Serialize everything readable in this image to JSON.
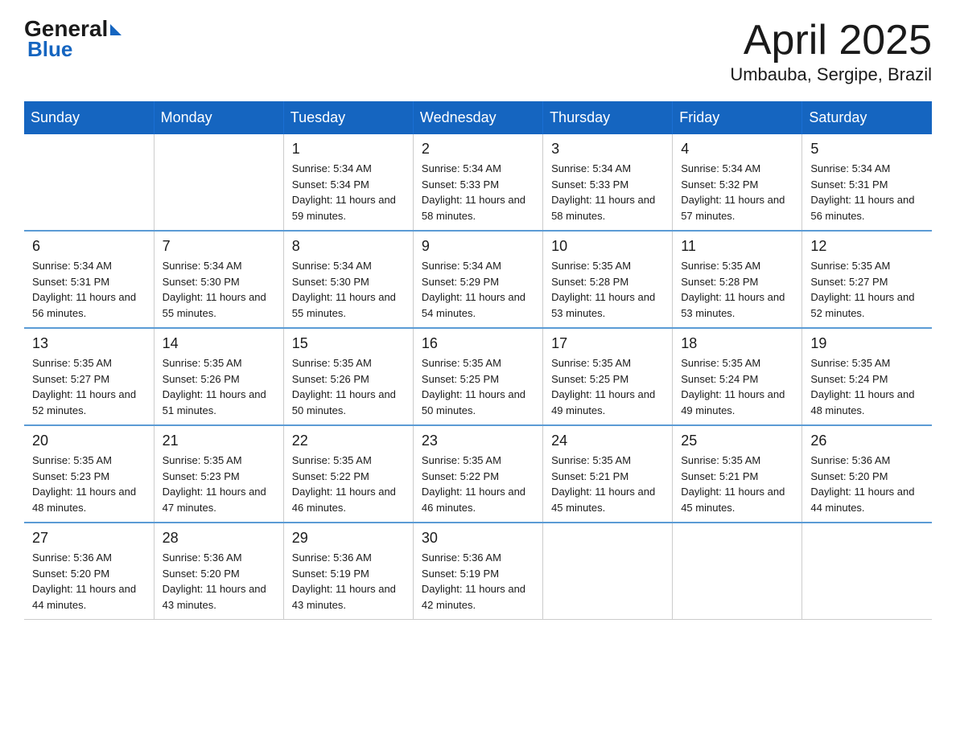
{
  "header": {
    "logo_general": "General",
    "logo_blue": "Blue",
    "month_title": "April 2025",
    "location": "Umbauba, Sergipe, Brazil"
  },
  "weekdays": [
    "Sunday",
    "Monday",
    "Tuesday",
    "Wednesday",
    "Thursday",
    "Friday",
    "Saturday"
  ],
  "weeks": [
    [
      {
        "day": "",
        "sunrise": "",
        "sunset": "",
        "daylight": ""
      },
      {
        "day": "",
        "sunrise": "",
        "sunset": "",
        "daylight": ""
      },
      {
        "day": "1",
        "sunrise": "Sunrise: 5:34 AM",
        "sunset": "Sunset: 5:34 PM",
        "daylight": "Daylight: 11 hours and 59 minutes."
      },
      {
        "day": "2",
        "sunrise": "Sunrise: 5:34 AM",
        "sunset": "Sunset: 5:33 PM",
        "daylight": "Daylight: 11 hours and 58 minutes."
      },
      {
        "day": "3",
        "sunrise": "Sunrise: 5:34 AM",
        "sunset": "Sunset: 5:33 PM",
        "daylight": "Daylight: 11 hours and 58 minutes."
      },
      {
        "day": "4",
        "sunrise": "Sunrise: 5:34 AM",
        "sunset": "Sunset: 5:32 PM",
        "daylight": "Daylight: 11 hours and 57 minutes."
      },
      {
        "day": "5",
        "sunrise": "Sunrise: 5:34 AM",
        "sunset": "Sunset: 5:31 PM",
        "daylight": "Daylight: 11 hours and 56 minutes."
      }
    ],
    [
      {
        "day": "6",
        "sunrise": "Sunrise: 5:34 AM",
        "sunset": "Sunset: 5:31 PM",
        "daylight": "Daylight: 11 hours and 56 minutes."
      },
      {
        "day": "7",
        "sunrise": "Sunrise: 5:34 AM",
        "sunset": "Sunset: 5:30 PM",
        "daylight": "Daylight: 11 hours and 55 minutes."
      },
      {
        "day": "8",
        "sunrise": "Sunrise: 5:34 AM",
        "sunset": "Sunset: 5:30 PM",
        "daylight": "Daylight: 11 hours and 55 minutes."
      },
      {
        "day": "9",
        "sunrise": "Sunrise: 5:34 AM",
        "sunset": "Sunset: 5:29 PM",
        "daylight": "Daylight: 11 hours and 54 minutes."
      },
      {
        "day": "10",
        "sunrise": "Sunrise: 5:35 AM",
        "sunset": "Sunset: 5:28 PM",
        "daylight": "Daylight: 11 hours and 53 minutes."
      },
      {
        "day": "11",
        "sunrise": "Sunrise: 5:35 AM",
        "sunset": "Sunset: 5:28 PM",
        "daylight": "Daylight: 11 hours and 53 minutes."
      },
      {
        "day": "12",
        "sunrise": "Sunrise: 5:35 AM",
        "sunset": "Sunset: 5:27 PM",
        "daylight": "Daylight: 11 hours and 52 minutes."
      }
    ],
    [
      {
        "day": "13",
        "sunrise": "Sunrise: 5:35 AM",
        "sunset": "Sunset: 5:27 PM",
        "daylight": "Daylight: 11 hours and 52 minutes."
      },
      {
        "day": "14",
        "sunrise": "Sunrise: 5:35 AM",
        "sunset": "Sunset: 5:26 PM",
        "daylight": "Daylight: 11 hours and 51 minutes."
      },
      {
        "day": "15",
        "sunrise": "Sunrise: 5:35 AM",
        "sunset": "Sunset: 5:26 PM",
        "daylight": "Daylight: 11 hours and 50 minutes."
      },
      {
        "day": "16",
        "sunrise": "Sunrise: 5:35 AM",
        "sunset": "Sunset: 5:25 PM",
        "daylight": "Daylight: 11 hours and 50 minutes."
      },
      {
        "day": "17",
        "sunrise": "Sunrise: 5:35 AM",
        "sunset": "Sunset: 5:25 PM",
        "daylight": "Daylight: 11 hours and 49 minutes."
      },
      {
        "day": "18",
        "sunrise": "Sunrise: 5:35 AM",
        "sunset": "Sunset: 5:24 PM",
        "daylight": "Daylight: 11 hours and 49 minutes."
      },
      {
        "day": "19",
        "sunrise": "Sunrise: 5:35 AM",
        "sunset": "Sunset: 5:24 PM",
        "daylight": "Daylight: 11 hours and 48 minutes."
      }
    ],
    [
      {
        "day": "20",
        "sunrise": "Sunrise: 5:35 AM",
        "sunset": "Sunset: 5:23 PM",
        "daylight": "Daylight: 11 hours and 48 minutes."
      },
      {
        "day": "21",
        "sunrise": "Sunrise: 5:35 AM",
        "sunset": "Sunset: 5:23 PM",
        "daylight": "Daylight: 11 hours and 47 minutes."
      },
      {
        "day": "22",
        "sunrise": "Sunrise: 5:35 AM",
        "sunset": "Sunset: 5:22 PM",
        "daylight": "Daylight: 11 hours and 46 minutes."
      },
      {
        "day": "23",
        "sunrise": "Sunrise: 5:35 AM",
        "sunset": "Sunset: 5:22 PM",
        "daylight": "Daylight: 11 hours and 46 minutes."
      },
      {
        "day": "24",
        "sunrise": "Sunrise: 5:35 AM",
        "sunset": "Sunset: 5:21 PM",
        "daylight": "Daylight: 11 hours and 45 minutes."
      },
      {
        "day": "25",
        "sunrise": "Sunrise: 5:35 AM",
        "sunset": "Sunset: 5:21 PM",
        "daylight": "Daylight: 11 hours and 45 minutes."
      },
      {
        "day": "26",
        "sunrise": "Sunrise: 5:36 AM",
        "sunset": "Sunset: 5:20 PM",
        "daylight": "Daylight: 11 hours and 44 minutes."
      }
    ],
    [
      {
        "day": "27",
        "sunrise": "Sunrise: 5:36 AM",
        "sunset": "Sunset: 5:20 PM",
        "daylight": "Daylight: 11 hours and 44 minutes."
      },
      {
        "day": "28",
        "sunrise": "Sunrise: 5:36 AM",
        "sunset": "Sunset: 5:20 PM",
        "daylight": "Daylight: 11 hours and 43 minutes."
      },
      {
        "day": "29",
        "sunrise": "Sunrise: 5:36 AM",
        "sunset": "Sunset: 5:19 PM",
        "daylight": "Daylight: 11 hours and 43 minutes."
      },
      {
        "day": "30",
        "sunrise": "Sunrise: 5:36 AM",
        "sunset": "Sunset: 5:19 PM",
        "daylight": "Daylight: 11 hours and 42 minutes."
      },
      {
        "day": "",
        "sunrise": "",
        "sunset": "",
        "daylight": ""
      },
      {
        "day": "",
        "sunrise": "",
        "sunset": "",
        "daylight": ""
      },
      {
        "day": "",
        "sunrise": "",
        "sunset": "",
        "daylight": ""
      }
    ]
  ]
}
